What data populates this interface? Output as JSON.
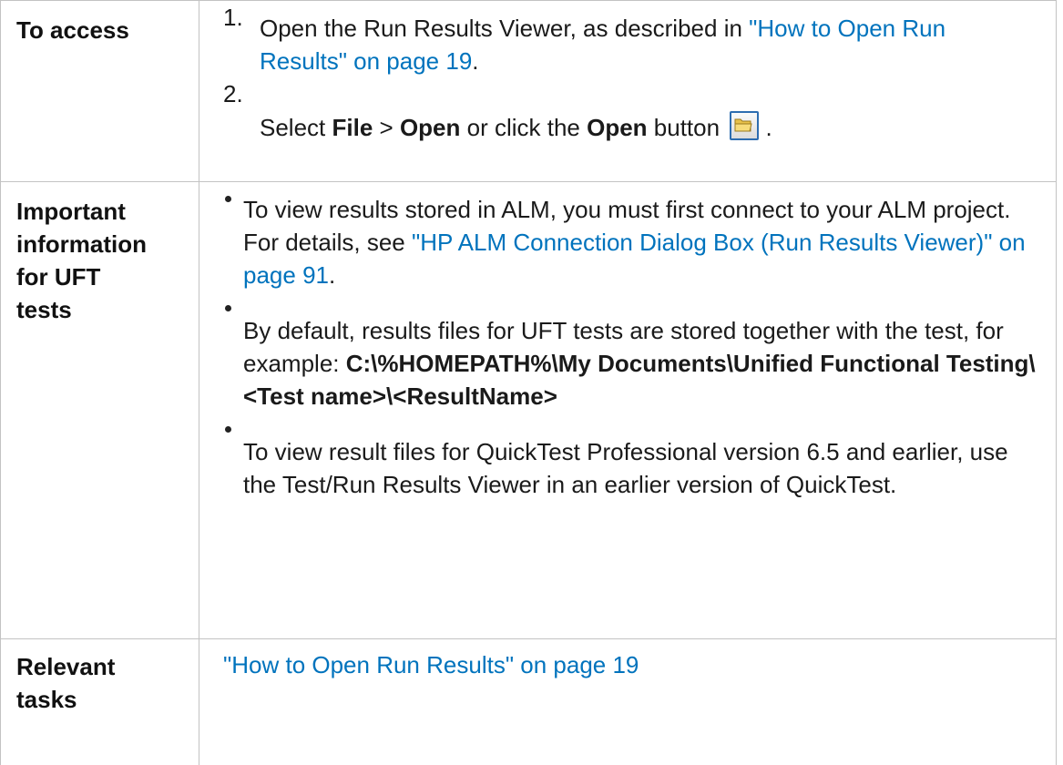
{
  "access": {
    "label": "To access",
    "step1": {
      "num": "1.",
      "pre": "Open the Run Results Viewer, as described in ",
      "link": "\"How to Open Run Results\" on page 19",
      "post": "."
    },
    "step2": {
      "num": "2.",
      "t1": "Select ",
      "file": "File",
      "t2": " > ",
      "open": "Open",
      "t3": " or click the ",
      "open_btn": "Open",
      "t4": " button ",
      "t5": " .",
      "icon": "open-folder-icon"
    }
  },
  "important": {
    "label_lines": [
      "Important",
      "information",
      "for UFT",
      "tests"
    ],
    "bullet1": {
      "pre": "To view results stored in ALM, you must first connect to your ALM project. For details, see ",
      "link": "\"HP ALM Connection Dialog Box (Run Results Viewer)\" on page 91",
      "post": "."
    },
    "bullet2": {
      "pre": "By default, results files for UFT tests are stored together with the test, for example: ",
      "path": "C:\\%HOMEPATH%\\My Documents\\Unified Functional Testing\\<Test name>\\<ResultName>"
    },
    "bullet3": {
      "text": "To view result files for QuickTest Professional version 6.5 and earlier, use the Test/Run Results Viewer in an earlier version of QuickTest."
    }
  },
  "tasks": {
    "label_lines": [
      "Relevant",
      "tasks"
    ],
    "link": "\"How to Open Run Results\" on page 19"
  },
  "colors": {
    "link": "#0073bd",
    "border": "#c3c3c3",
    "text": "#1a1a1a"
  }
}
